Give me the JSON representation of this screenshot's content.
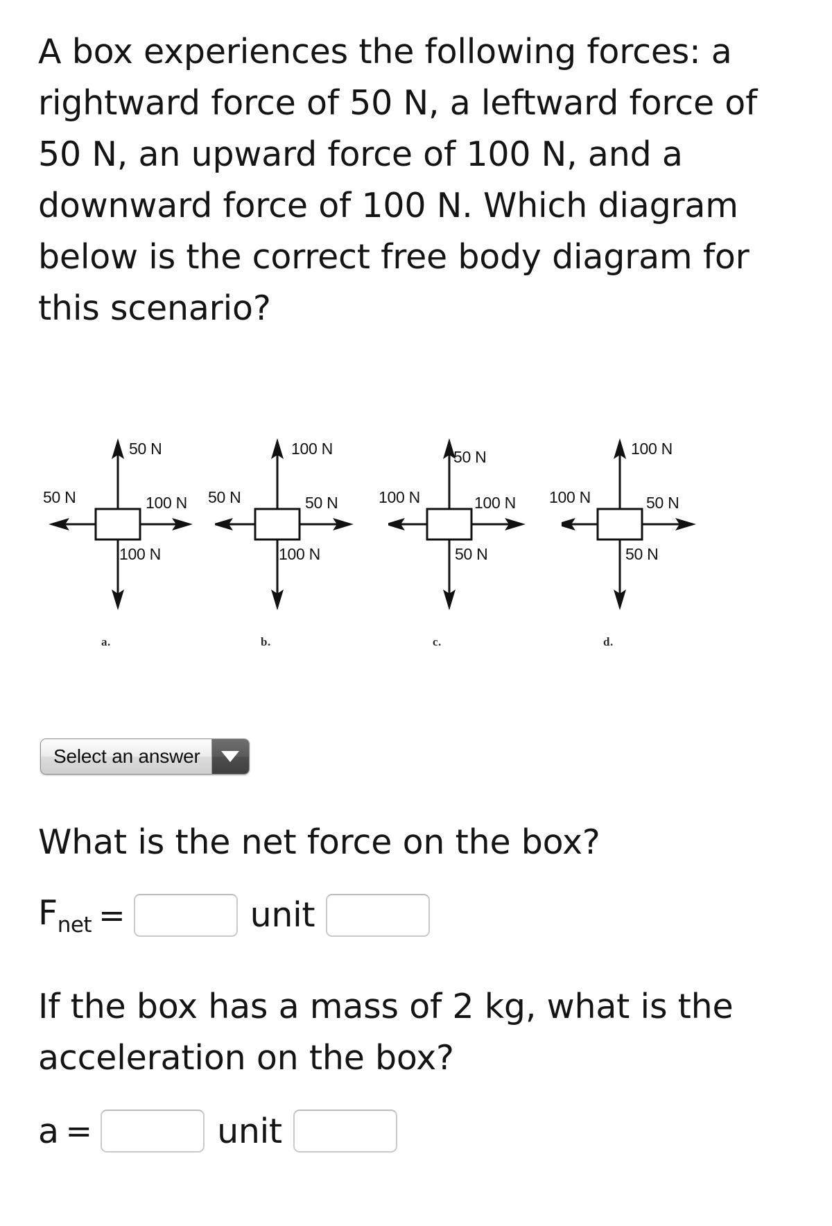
{
  "question": {
    "prompt": "A box experiences the following forces:  a rightward force of 50 N, a leftward force of 50 N, an upward force of 100 N, and a downward force of 100 N.  Which diagram below is the correct free body diagram for this scenario?"
  },
  "diagrams": [
    {
      "tag": "a.",
      "up": "50 N",
      "left": "50 N",
      "right": "100 N",
      "down": "100 N"
    },
    {
      "tag": "b.",
      "up": "100 N",
      "left": "50 N",
      "right": "50 N",
      "down": "100 N"
    },
    {
      "tag": "c.",
      "up": "50 N",
      "left": "100 N",
      "right": "100 N",
      "down": "50 N"
    },
    {
      "tag": "d.",
      "up": "100 N",
      "left": "100 N",
      "right": "50 N",
      "down": "50 N"
    }
  ],
  "dropdown": {
    "selected_label": "Select an answer",
    "arrow_icon": "chevron-down-icon"
  },
  "net_force": {
    "question": "What is the net force on the box?",
    "symbol": "F",
    "subscript": "net",
    "equals": "=",
    "value": "",
    "unit_label": "unit",
    "unit_value": ""
  },
  "acceleration": {
    "question": "If the box has a mass of 2 kg, what is the acceleration on the box?",
    "symbol": "a",
    "equals": "=",
    "value": "",
    "unit_label": "unit",
    "unit_value": ""
  },
  "colors": {
    "text": "#141414",
    "diagram_stroke": "#111111",
    "input_border": "#c9c9c9"
  }
}
